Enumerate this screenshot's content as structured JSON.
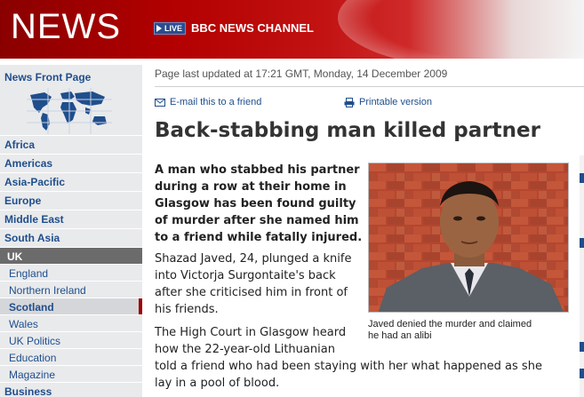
{
  "header": {
    "brand": "NEWS",
    "live_label": "LIVE",
    "channel": "BBC NEWS CHANNEL"
  },
  "sidebar": {
    "front_page": "News Front Page",
    "items": [
      {
        "label": "Africa"
      },
      {
        "label": "Americas"
      },
      {
        "label": "Asia-Pacific"
      },
      {
        "label": "Europe"
      },
      {
        "label": "Middle East"
      },
      {
        "label": "South Asia"
      },
      {
        "label": "UK"
      },
      {
        "label": "England"
      },
      {
        "label": "Northern Ireland"
      },
      {
        "label": "Scotland"
      },
      {
        "label": "Wales"
      },
      {
        "label": "UK Politics"
      },
      {
        "label": "Education"
      },
      {
        "label": "Magazine"
      },
      {
        "label": "Business"
      }
    ]
  },
  "article": {
    "updated": "Page last updated at 17:21 GMT, Monday, 14 December 2009",
    "email_link": "E-mail this to a friend",
    "print_link": "Printable version",
    "headline": "Back-stabbing man killed partner",
    "intro_lines": [
      "A man who stabbed his partner",
      "during a row at their home in",
      "Glasgow has been found guilty",
      "of murder after she named him",
      "to a friend while fatally injured."
    ],
    "para1_lines": [
      "Shazad Javed, 24, plunged a knife",
      "into Victorja Surgontaite's back",
      "after she criticised him in front of",
      "his friends."
    ],
    "para2_lines": [
      "The High Court in Glasgow heard",
      "how the 22-year-old Lithuanian",
      "told a friend who had been staying with her what happened as she",
      "lay in a pool of blood."
    ],
    "caption_lines": [
      "Javed denied the murder and claimed",
      "he had an alibi"
    ]
  },
  "colors": {
    "brand_red": "#b30000",
    "link_blue": "#1f4e8c",
    "sidebar_bg": "#e9eaec",
    "selected_marker": "#990000"
  },
  "icons": {
    "globe": "world-map-icon",
    "email": "envelope-icon",
    "print": "printer-icon",
    "live": "play-icon"
  }
}
